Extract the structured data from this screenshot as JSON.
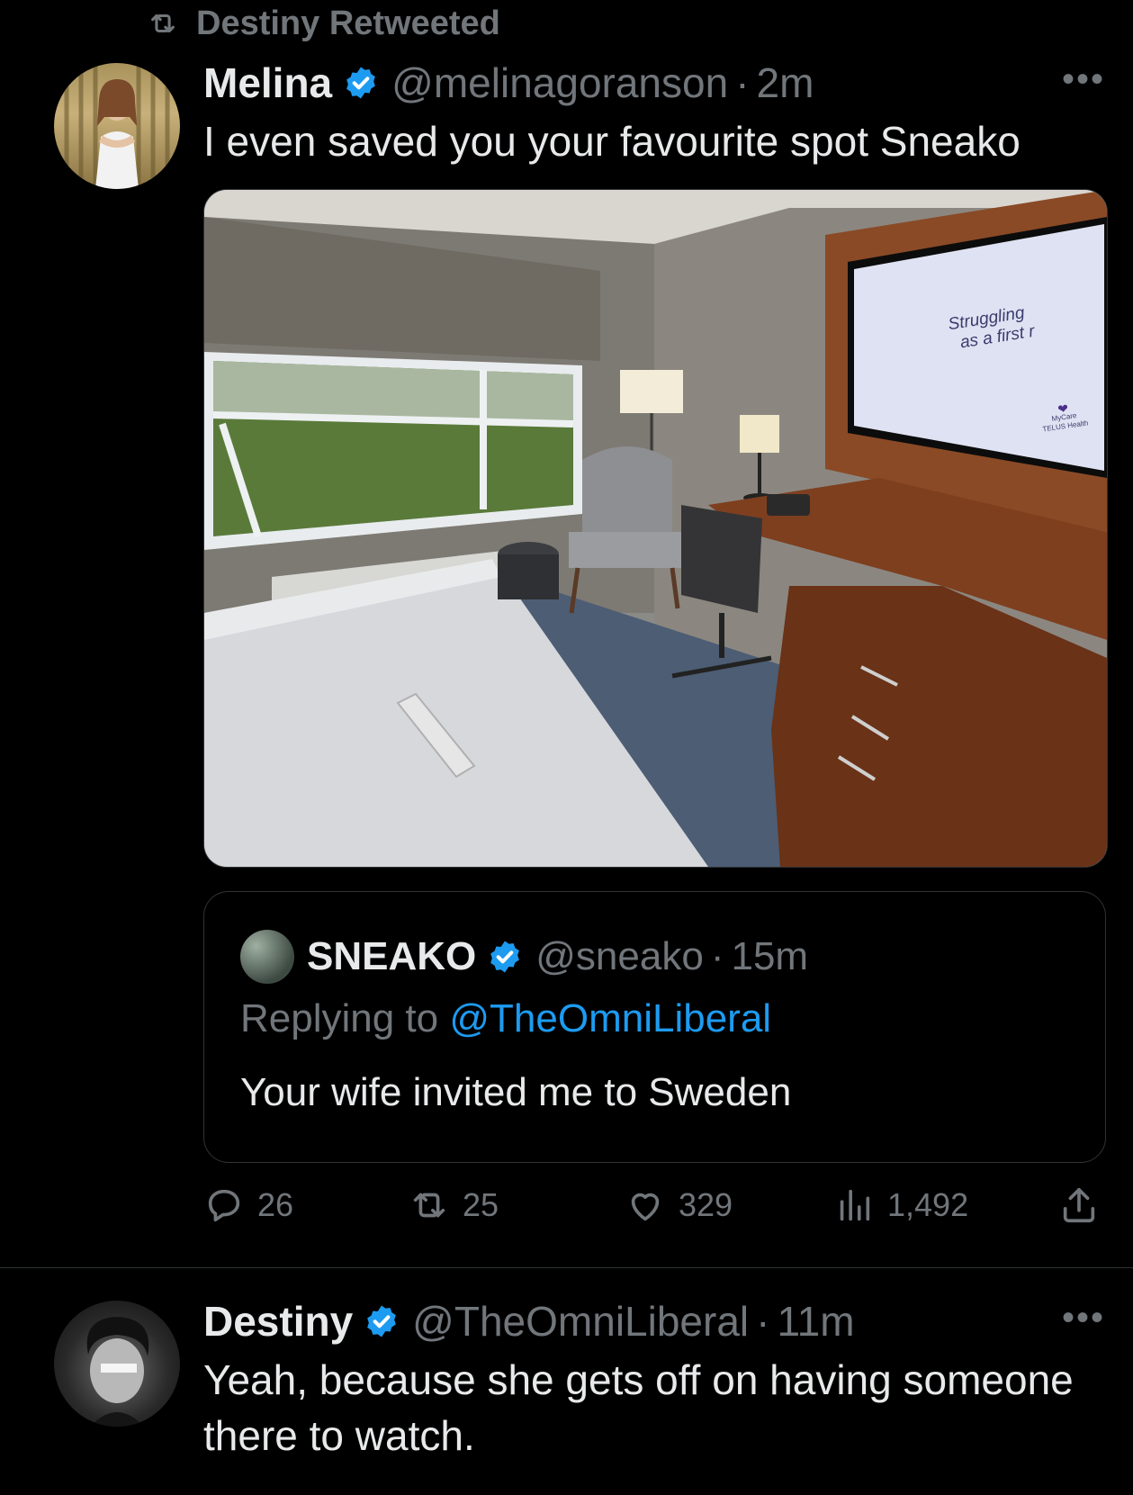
{
  "retweet_banner": {
    "text": "Destiny Retweeted"
  },
  "tweet1": {
    "name": "Melina",
    "handle": "@melinagoranson",
    "time": "2m",
    "text": "I even saved you your favourite spot Sneako",
    "media": {
      "tv_text_1": "Struggling",
      "tv_text_2": "as a first r",
      "tv_brand_1": "MyCare",
      "tv_brand_2": "TELUS Health"
    },
    "quote": {
      "name": "SNEAKO",
      "handle": "@sneako",
      "time": "15m",
      "replying_prefix": "Replying to",
      "replying_handle": "@TheOmniLiberal",
      "text": "Your wife invited me to Sweden"
    },
    "stats": {
      "replies": "26",
      "retweets": "25",
      "likes": "329",
      "views": "1,492"
    }
  },
  "tweet2": {
    "name": "Destiny",
    "handle": "@TheOmniLiberal",
    "time": "11m",
    "text_line1": "Yeah, because she gets off on having someone",
    "text_line2": "there to watch."
  },
  "separator_dot": "·",
  "more_label": "•••",
  "colors": {
    "background": "#000000",
    "text": "#e7e9ea",
    "muted": "#71767b",
    "accent": "#1d9bf0",
    "border": "#2f3336"
  }
}
